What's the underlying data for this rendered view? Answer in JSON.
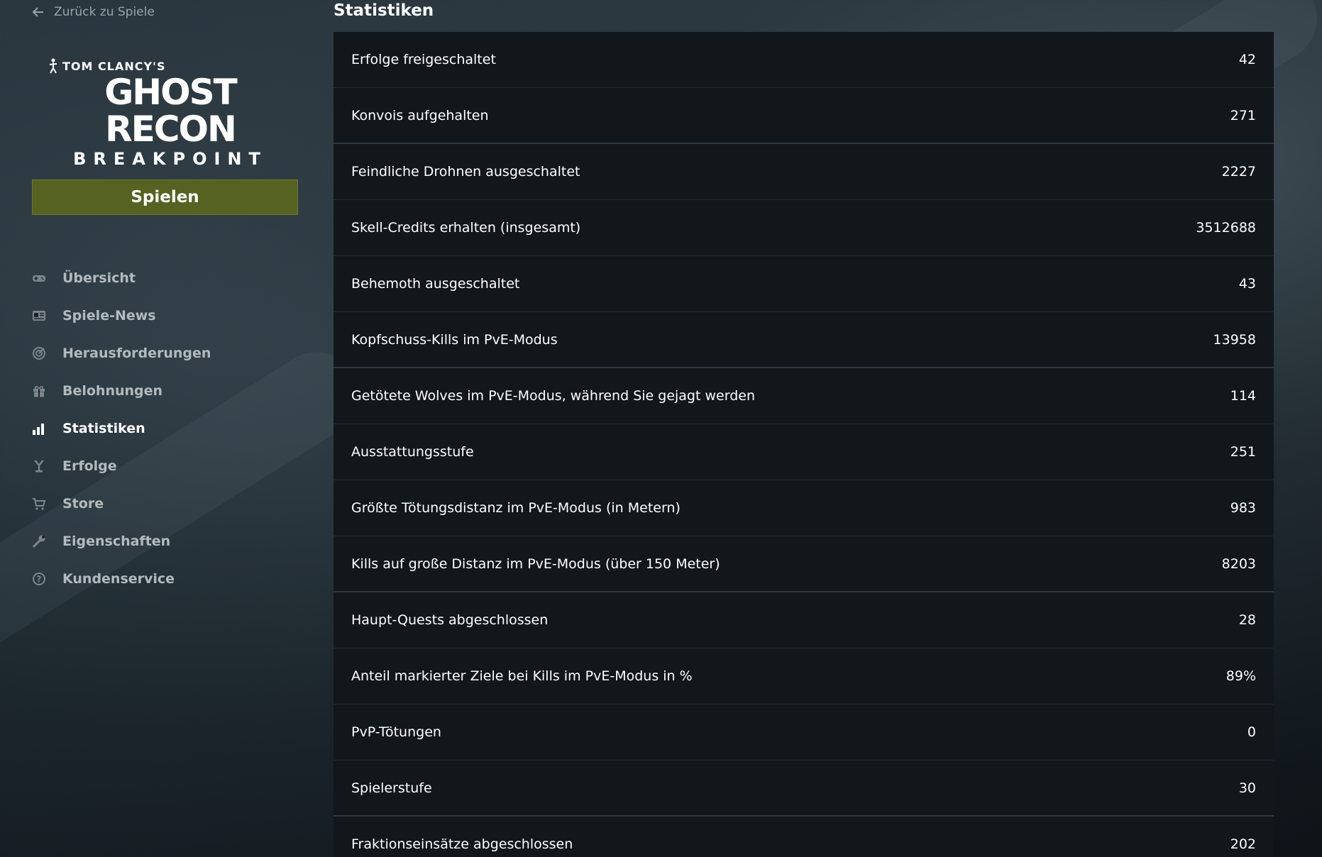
{
  "back_link": {
    "label": "Zurück zu Spiele",
    "icon": "arrow-left-icon"
  },
  "logo": {
    "top": "TOM CLANCY'S",
    "main": "GHOST RECON",
    "sub": "BREAKPOINT"
  },
  "play_button": {
    "label": "Spielen",
    "color": "#556221"
  },
  "nav": {
    "items": [
      {
        "label": "Übersicht",
        "icon": "gamepad-icon",
        "active": false
      },
      {
        "label": "Spiele-News",
        "icon": "news-icon",
        "active": false
      },
      {
        "label": "Herausforderungen",
        "icon": "target-icon",
        "active": false
      },
      {
        "label": "Belohnungen",
        "icon": "gift-icon",
        "active": false
      },
      {
        "label": "Statistiken",
        "icon": "bar-chart-icon",
        "active": true
      },
      {
        "label": "Erfolge",
        "icon": "trophy-icon",
        "active": false
      },
      {
        "label": "Store",
        "icon": "cart-icon",
        "active": false
      },
      {
        "label": "Eigenschaften",
        "icon": "wrench-icon",
        "active": false
      },
      {
        "label": "Kundenservice",
        "icon": "help-icon",
        "active": false
      }
    ]
  },
  "main": {
    "title": "Statistiken",
    "stats": [
      {
        "label": "Erfolge freigeschaltet",
        "value": "42"
      },
      {
        "label": "Konvois aufgehalten",
        "value": "271"
      },
      {
        "label": "Feindliche Drohnen ausgeschaltet",
        "value": "2227"
      },
      {
        "label": "Skell-Credits erhalten (insgesamt)",
        "value": "3512688"
      },
      {
        "label": "Behemoth ausgeschaltet",
        "value": "43"
      },
      {
        "label": "Kopfschuss-Kills im PvE-Modus",
        "value": "13958"
      },
      {
        "label": "Getötete Wolves im PvE-Modus, während Sie gejagt werden",
        "value": "114"
      },
      {
        "label": "Ausstattungsstufe",
        "value": "251"
      },
      {
        "label": "Größte Tötungsdistanz im PvE-Modus (in Metern)",
        "value": "983"
      },
      {
        "label": "Kills auf große Distanz im PvE-Modus (über 150 Meter)",
        "value": "8203"
      },
      {
        "label": "Haupt-Quests abgeschlossen",
        "value": "28"
      },
      {
        "label": "Anteil markierter Ziele bei Kills im PvE-Modus in %",
        "value": "89%"
      },
      {
        "label": "PvP-Tötungen",
        "value": "0"
      },
      {
        "label": "Spielerstufe",
        "value": "30"
      },
      {
        "label": "Fraktionseinsätze abgeschlossen",
        "value": "202"
      }
    ]
  }
}
